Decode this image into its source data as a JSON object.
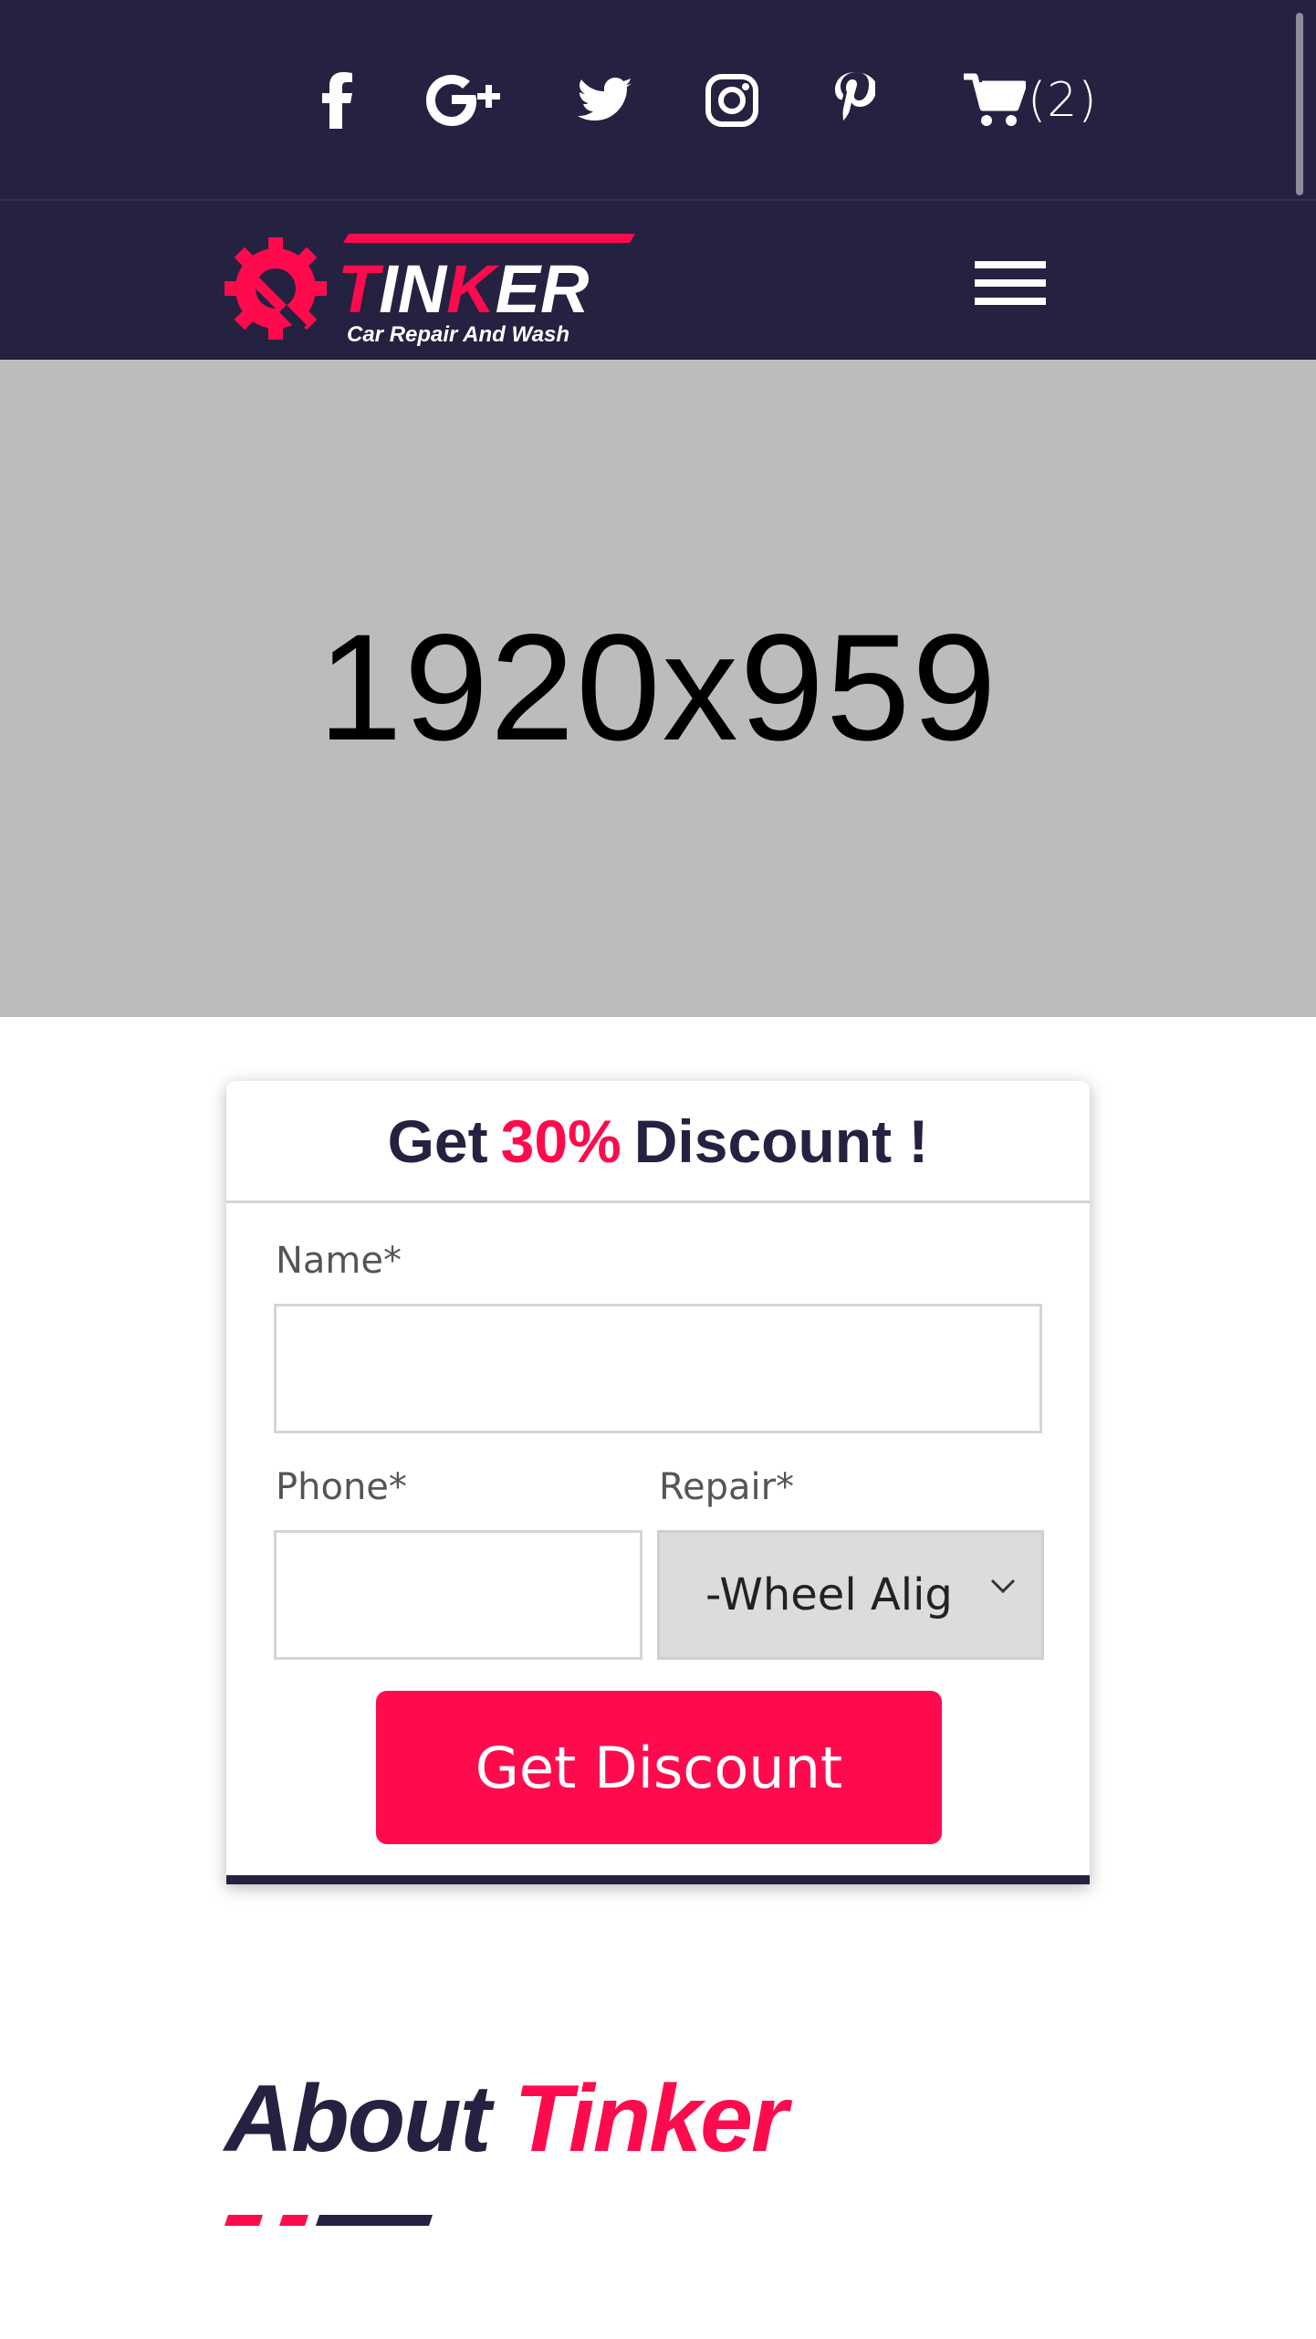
{
  "topbar": {
    "social": [
      {
        "icon": "facebook-icon"
      },
      {
        "icon": "google-plus-icon"
      },
      {
        "icon": "twitter-icon"
      },
      {
        "icon": "instagram-icon"
      },
      {
        "icon": "pinterest-icon"
      }
    ],
    "cart": {
      "icon": "cart-icon",
      "count": "(2)"
    }
  },
  "navbar": {
    "logo": {
      "brand": "TINKER",
      "tagline": "Car Repair And Wash"
    },
    "menu_icon": "hamburger-menu-icon"
  },
  "hero": {
    "placeholder_text": "1920x959"
  },
  "discount_form": {
    "title_prefix": "Get",
    "title_accent": "30%",
    "title_suffix": "Discount !",
    "name_label": "Name*",
    "name_value": "",
    "phone_label": "Phone*",
    "phone_value": "",
    "repair_label": "Repair*",
    "repair_selected": "-Wheel Alig",
    "submit_label": "Get Discount"
  },
  "about": {
    "title_prefix": "About",
    "title_accent": "Tinker"
  },
  "colors": {
    "navy": "#252140",
    "accent": "#fe0b4d",
    "hero_gray": "#bcbcbc"
  }
}
